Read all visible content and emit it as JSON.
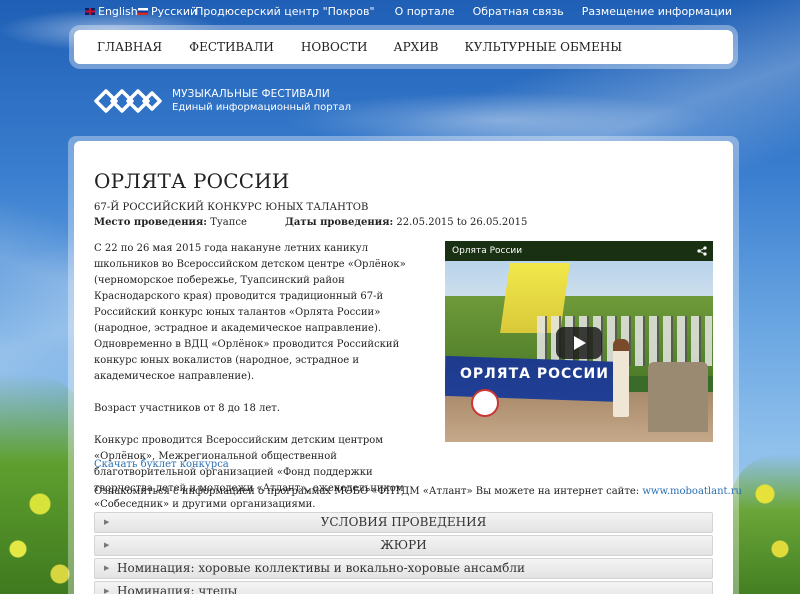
{
  "topbar": {
    "lang_en": "English",
    "lang_ru": "Русский",
    "links": [
      "Продюсерский центр \"Покров\"",
      "О портале",
      "Обратная связь",
      "Размещение информации"
    ]
  },
  "nav": {
    "items": [
      "ГЛАВНАЯ",
      "ФЕСТИВАЛИ",
      "НОВОСТИ",
      "АРХИВ",
      "КУЛЬТУРНЫЕ ОБМЕНЫ"
    ]
  },
  "logo": {
    "line1": "МУЗЫКАЛЬНЫЕ ФЕСТИВАЛИ",
    "line2": "Единый информационный портал"
  },
  "page": {
    "title": "ОРЛЯТА РОССИИ",
    "subtitle": "67-Й РОССИЙСКИЙ КОНКУРС ЮНЫХ ТАЛАНТОВ",
    "place_label": "Место проведения:",
    "place_value": " Туапсе",
    "dates_label": "Даты проведения:",
    "dates_value": " 22.05.2015 to 26.05.2015",
    "paragraphs": [
      "С 22 по 26 мая 2015 года накануне летних каникул школьников во Всероссийском детском центре «Орлёнок» (черноморское побережье, Туапсинский район Краснодарского края) проводится традиционный 67-й Российский конкурс юных талантов «Орлята России» (народное, эстрадное и академическое направление).",
      "Одновременно в ВДЦ «Орлёнок» проводится Российский конкурс юных вокалистов (народное, эстрадное и академическое направление).",
      "Возраст участников от 8 до 18 лет.",
      "Конкурс проводится Всероссийским детским центром «Орлёнок», Межрегиональной общественной благотворительной организацией «Фонд поддержки творчества детей и молодежи «Атлант», еженедельником «Собеседник» и другими организациями."
    ],
    "download_link": "Скачать буклет конкурса",
    "info_text": "Ознакомиться с информацией о программах МОБО «ФПТДМ «Атлант» Вы можете на интернет сайте: ",
    "info_site": "www.moboatlant.ru"
  },
  "video": {
    "title": "Орлята России",
    "banner": "ОРЛЯТА РОССИИ",
    "share_icon": "share-icon",
    "play_icon": "play-icon"
  },
  "accordion": [
    {
      "label": "УСЛОВИЯ ПРОВЕДЕНИЯ"
    },
    {
      "label": "ЖЮРИ"
    },
    {
      "label": "Номинация: хоровые коллективы и вокально-хоровые ансамбли"
    },
    {
      "label": "Номинация: чтецы"
    }
  ]
}
